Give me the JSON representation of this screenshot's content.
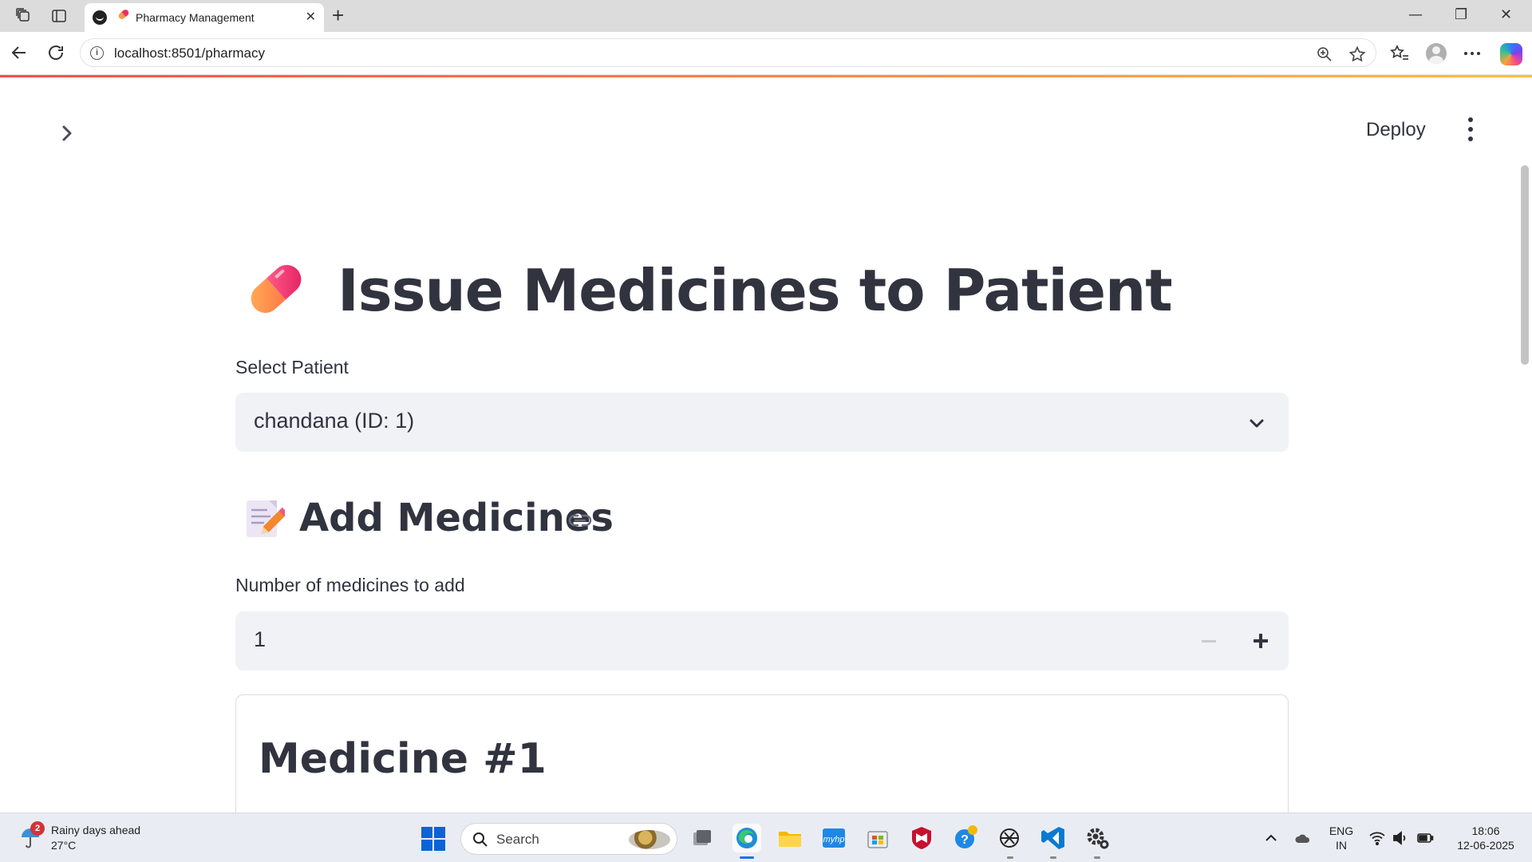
{
  "browser": {
    "tab_title": "Pharmacy Management",
    "tab_close": "✕",
    "new_tab": "+",
    "url_host": "localhost",
    "url_rest": ":8501/pharmacy",
    "window_controls": [
      "—",
      "❐",
      "✕"
    ]
  },
  "app": {
    "deploy_label": "Deploy",
    "page_title": "Issue Medicines to Patient",
    "patient_label": "Select Patient",
    "patient_selected": "chandana (ID: 1)",
    "section_title": "Add Medicines",
    "count_label": "Number of medicines to add",
    "count_value": "1",
    "card_title": "Medicine #1"
  },
  "taskbar": {
    "weather_badge": "2",
    "weather_line1": "Rainy days ahead",
    "weather_line2": "27°C",
    "search_placeholder": "Search",
    "lang_line1": "ENG",
    "lang_line2": "IN",
    "time": "18:06",
    "date": "12-06-2025"
  },
  "colors": {
    "accent_start": "#ff4b4b",
    "accent_end": "#ffbd45",
    "input_bg": "#f0f2f6",
    "text": "#31333f"
  }
}
